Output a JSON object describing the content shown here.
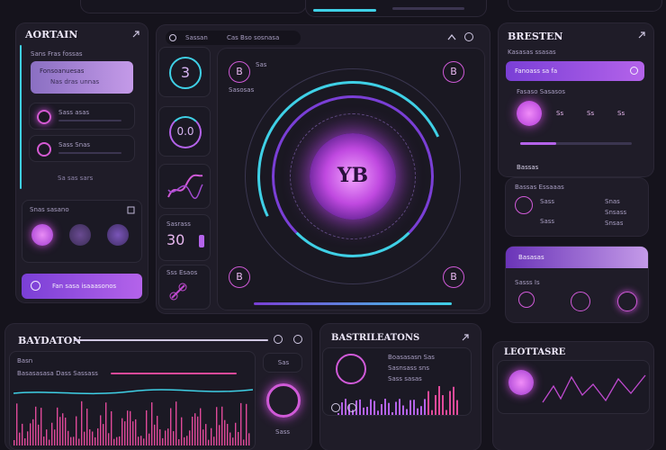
{
  "top_strip": {
    "label_a": "",
    "label_b": ""
  },
  "left_panel": {
    "title": "AORTAIN",
    "subtitle": "Sans Fras fossas",
    "card1_title": "Fonsoanuesas",
    "card1_text": "Nas dras unnas",
    "item1_label": "Sass asas",
    "item2_label": "Sass Snas",
    "link_label": "Sa sas sars",
    "sub_title": "Snas sasano",
    "action_label": "Fan sasa isaaasonos"
  },
  "center": {
    "header_a": "Sassan",
    "header_b": "Cas Bso sosnasa",
    "dial_value": "YB",
    "tile1_value": "3",
    "tile2_value": "0.0",
    "tile4_label": "Sasrass",
    "tile4_value": "30",
    "tile5_label": "Sss Esaos",
    "corner_tl": "B",
    "corner_tr": "B",
    "corner_bl": "B",
    "corner_br": "B",
    "corner_tl_small": "Sas",
    "corner_tl_caption": "Sasosas"
  },
  "right_panel": {
    "title": "BRESTEN",
    "subtitle": "Kasasas ssasas",
    "highlight_label": "Fanoass sa fa",
    "section_label": "Fasaso Sasasos",
    "mini1": "Ss",
    "mini2": "Ss",
    "mini3": "Ss",
    "list_title": "Bassas",
    "sub_card_title": "Bassas Essaaas",
    "sub_card_item": "Sass",
    "sub_card_item2": "Sass",
    "side_item1": "Snas",
    "side_item2": "Snsass",
    "side_item3": "Snsas",
    "promo_label": "Basasas",
    "promo_sub": "Sasss  Is"
  },
  "bottom_left": {
    "title": "BAYDATON",
    "label": "Basn",
    "caption": "Basasasasa Dass Sassass",
    "side_label": "Sas",
    "side_sub": "Sass",
    "chip_value": "Sas"
  },
  "bottom_middle": {
    "title": "BASTRILEATONS",
    "line1": "Boasasasn Sas",
    "line2": "Sasnsass sns",
    "line3": "Sass sasas"
  },
  "bottom_right": {
    "title": "LEOTTASRE"
  },
  "colors": {
    "accent": "#b463ea",
    "cyan": "#3fd0e6",
    "pink": "#e04a9a",
    "bg": "#15131c"
  },
  "icons": [
    "play-icon",
    "chevron-up-icon",
    "circle-icon",
    "wave-icon",
    "heart-icon",
    "settings-icon"
  ]
}
